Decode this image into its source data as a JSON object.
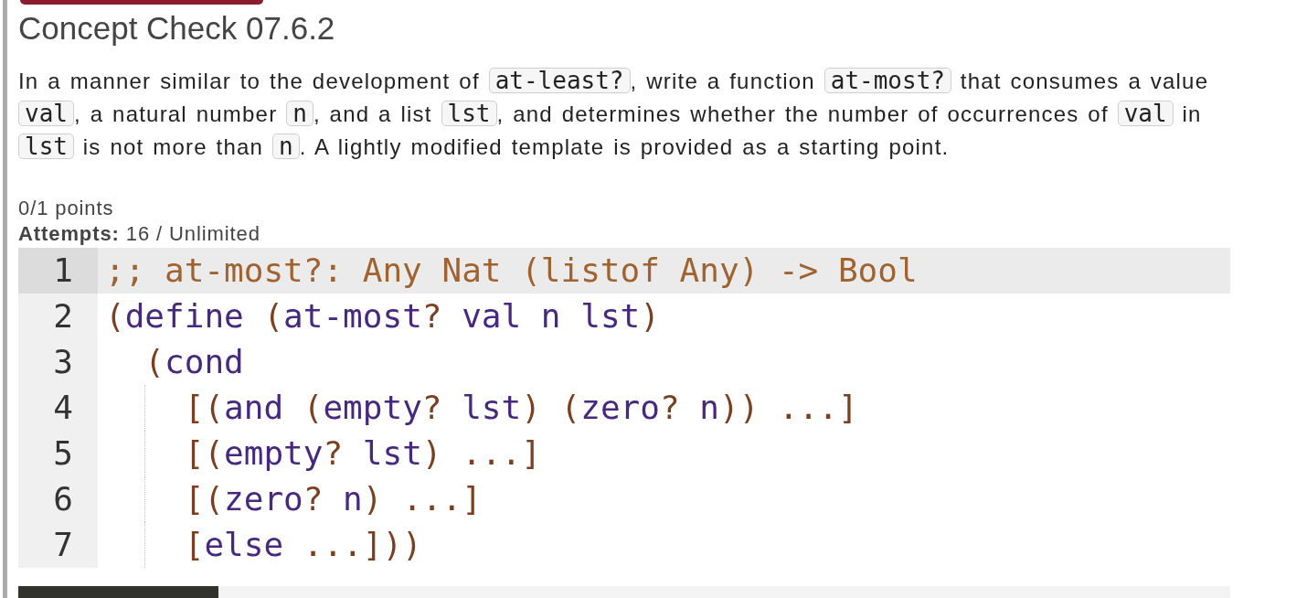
{
  "title": "Concept Check 07.6.2",
  "prompt": [
    {
      "kind": "text",
      "text": "In a manner similar to the development of "
    },
    {
      "kind": "code",
      "text": "at-least?"
    },
    {
      "kind": "text",
      "text": ", write a function "
    },
    {
      "kind": "code",
      "text": "at-most?"
    },
    {
      "kind": "text",
      "text": " that consumes a value "
    },
    {
      "kind": "code",
      "text": "val"
    },
    {
      "kind": "text",
      "text": ", a natural number "
    },
    {
      "kind": "code",
      "text": "n"
    },
    {
      "kind": "text",
      "text": ", and a list "
    },
    {
      "kind": "code",
      "text": "lst"
    },
    {
      "kind": "text",
      "text": ", and determines whether the number of occurrences of "
    },
    {
      "kind": "code",
      "text": "val"
    },
    {
      "kind": "text",
      "text": " in "
    },
    {
      "kind": "code",
      "text": "lst"
    },
    {
      "kind": "text",
      "text": " is not more than "
    },
    {
      "kind": "code",
      "text": "n"
    },
    {
      "kind": "text",
      "text": ". A lightly modified template is provided as a starting point."
    }
  ],
  "score": "0/1 points",
  "attempts": "**Attempts:** 16 / Unlimited",
  "editor": {
    "lines": [
      {
        "number": "1",
        "active": true,
        "indent_guide": false,
        "tokens": [
          {
            "kind": "comment",
            "text": ";; at-most?: Any Nat (listof Any) -> Bool"
          }
        ]
      },
      {
        "number": "2",
        "active": false,
        "indent_guide": false,
        "tokens": [
          {
            "kind": "punct",
            "text": "("
          },
          {
            "kind": "word",
            "text": "define "
          },
          {
            "kind": "punct",
            "text": "("
          },
          {
            "kind": "word",
            "text": "at-most"
          },
          {
            "kind": "punct",
            "text": "?"
          },
          {
            "kind": "word",
            "text": " val n lst"
          },
          {
            "kind": "punct",
            "text": ")"
          }
        ]
      },
      {
        "number": "3",
        "active": false,
        "indent_guide": false,
        "tokens": [
          {
            "kind": "punct",
            "text": "  ("
          },
          {
            "kind": "word",
            "text": "cond"
          }
        ]
      },
      {
        "number": "4",
        "active": false,
        "indent_guide": true,
        "tokens": [
          {
            "kind": "punct",
            "text": "    [("
          },
          {
            "kind": "word",
            "text": "and "
          },
          {
            "kind": "punct",
            "text": "("
          },
          {
            "kind": "word",
            "text": "empty"
          },
          {
            "kind": "punct",
            "text": "?"
          },
          {
            "kind": "word",
            "text": " lst"
          },
          {
            "kind": "punct",
            "text": ") ("
          },
          {
            "kind": "word",
            "text": "zero"
          },
          {
            "kind": "punct",
            "text": "?"
          },
          {
            "kind": "word",
            "text": " n"
          },
          {
            "kind": "punct",
            "text": ")) ...]"
          }
        ]
      },
      {
        "number": "5",
        "active": false,
        "indent_guide": true,
        "tokens": [
          {
            "kind": "punct",
            "text": "    [("
          },
          {
            "kind": "word",
            "text": "empty"
          },
          {
            "kind": "punct",
            "text": "?"
          },
          {
            "kind": "word",
            "text": " lst"
          },
          {
            "kind": "punct",
            "text": ") ...]"
          }
        ]
      },
      {
        "number": "6",
        "active": false,
        "indent_guide": true,
        "tokens": [
          {
            "kind": "punct",
            "text": "    [("
          },
          {
            "kind": "word",
            "text": "zero"
          },
          {
            "kind": "punct",
            "text": "?"
          },
          {
            "kind": "word",
            "text": " n"
          },
          {
            "kind": "punct",
            "text": ") ...]"
          }
        ]
      },
      {
        "number": "7",
        "active": false,
        "indent_guide": true,
        "tokens": [
          {
            "kind": "punct",
            "text": "    ["
          },
          {
            "kind": "word",
            "text": "else"
          },
          {
            "kind": "punct",
            "text": " ...]))"
          }
        ]
      }
    ]
  }
}
